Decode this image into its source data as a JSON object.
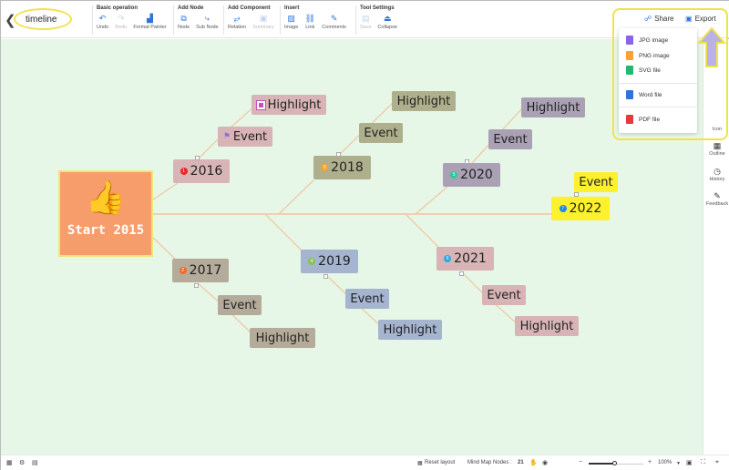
{
  "header": {
    "back_icon": "chevron-left-icon",
    "title": "timeline",
    "groups": [
      {
        "label": "Basic operation",
        "tools": [
          {
            "label": "Undo",
            "icon": "undo-icon",
            "glyph": "↶",
            "disabled": false
          },
          {
            "label": "Redo",
            "icon": "redo-icon",
            "glyph": "↷",
            "disabled": true
          },
          {
            "label": "Format Painter",
            "icon": "format-painter-icon",
            "glyph": "▟",
            "disabled": false
          }
        ]
      },
      {
        "label": "Add Node",
        "tools": [
          {
            "label": "Node",
            "icon": "node-icon",
            "glyph": "⧉",
            "disabled": false
          },
          {
            "label": "Sub Node",
            "icon": "sub-node-icon",
            "glyph": "⤷",
            "disabled": false
          }
        ]
      },
      {
        "label": "Add Component",
        "tools": [
          {
            "label": "Relation",
            "icon": "relation-icon",
            "glyph": "⥂",
            "disabled": false
          },
          {
            "label": "Summary",
            "icon": "summary-icon",
            "glyph": "▣",
            "disabled": true
          }
        ]
      },
      {
        "label": "Insert",
        "tools": [
          {
            "label": "Image",
            "icon": "image-icon",
            "glyph": "▨",
            "disabled": false
          },
          {
            "label": "Link",
            "icon": "link-icon",
            "glyph": "⛓",
            "disabled": false
          },
          {
            "label": "Comments",
            "icon": "comments-icon",
            "glyph": "✎",
            "disabled": false
          }
        ]
      },
      {
        "label": "Tool Settings",
        "tools": [
          {
            "label": "Save",
            "icon": "save-icon",
            "glyph": "▤",
            "disabled": true
          },
          {
            "label": "Collapse",
            "icon": "collapse-icon",
            "glyph": "⏏",
            "disabled": false
          }
        ]
      }
    ],
    "share_label": "Share",
    "export_label": "Export"
  },
  "export_menu": {
    "items": [
      {
        "label": "JPG image",
        "color": "#8b62e8"
      },
      {
        "label": "PNG image",
        "color": "#f5a23a"
      },
      {
        "label": "SVG file",
        "color": "#21b86f"
      },
      {
        "label": "Word file",
        "color": "#2f73d8"
      },
      {
        "label": "PDF file",
        "color": "#e33a3a"
      }
    ]
  },
  "right_panel": {
    "items": [
      {
        "label": "Icon",
        "icon": "icon-panel-icon"
      },
      {
        "label": "Outline",
        "icon": "outline-icon"
      },
      {
        "label": "History",
        "icon": "history-icon"
      },
      {
        "label": "Feedback",
        "icon": "feedback-icon"
      }
    ]
  },
  "mindmap": {
    "root": {
      "label": "Start 2015",
      "icon": "thumbs-up-icon",
      "color": "#f79d6c"
    },
    "years": [
      {
        "label": "2016",
        "badge": "1",
        "badge_color": "#e82727",
        "color": "#d8b4b6"
      },
      {
        "label": "2017",
        "badge": "2",
        "badge_color": "#f36b22",
        "color": "#b5ab9b"
      },
      {
        "label": "2018",
        "badge": "3",
        "badge_color": "#f5a623",
        "color": "#aeb08d"
      },
      {
        "label": "2019",
        "badge": "4",
        "badge_color": "#8bc34a",
        "color": "#a5b4cf"
      },
      {
        "label": "2020",
        "badge": "5",
        "badge_color": "#2ec99b",
        "color": "#aaa1b5"
      },
      {
        "label": "2021",
        "badge": "6",
        "badge_color": "#29a9e8",
        "color": "#d8b4b6"
      },
      {
        "label": "2022",
        "badge": "7",
        "badge_color": "#1e88e5",
        "color": "#fdf02c"
      }
    ],
    "event_label": "Event",
    "highlight_label": "Highlight"
  },
  "footer": {
    "reset_layout": "Reset layout",
    "nodes_label": "Mind Map Nodes :",
    "nodes_count": "21",
    "zoom_level": "100%",
    "zoom_fraction": 0.47
  }
}
